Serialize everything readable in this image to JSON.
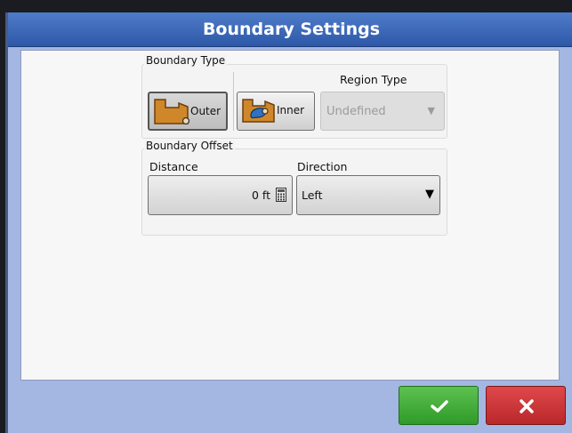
{
  "dialog": {
    "title": "Boundary Settings"
  },
  "boundary_type": {
    "label": "Boundary Type",
    "outer_label": "Outer",
    "inner_label": "Inner",
    "selected": "Outer",
    "region_type": {
      "label": "Region Type",
      "value": "Undefined",
      "enabled": false
    }
  },
  "boundary_offset": {
    "label": "Boundary Offset",
    "distance": {
      "label": "Distance",
      "value": "0 ft"
    },
    "direction": {
      "label": "Direction",
      "value": "Left"
    }
  },
  "footer": {
    "ok_icon": "checkmark-icon",
    "cancel_icon": "x-icon"
  },
  "colors": {
    "title_bar": "#3a67b8",
    "frame": "#a3b7e2",
    "ok": "#3fae36",
    "cancel": "#cc3436"
  }
}
